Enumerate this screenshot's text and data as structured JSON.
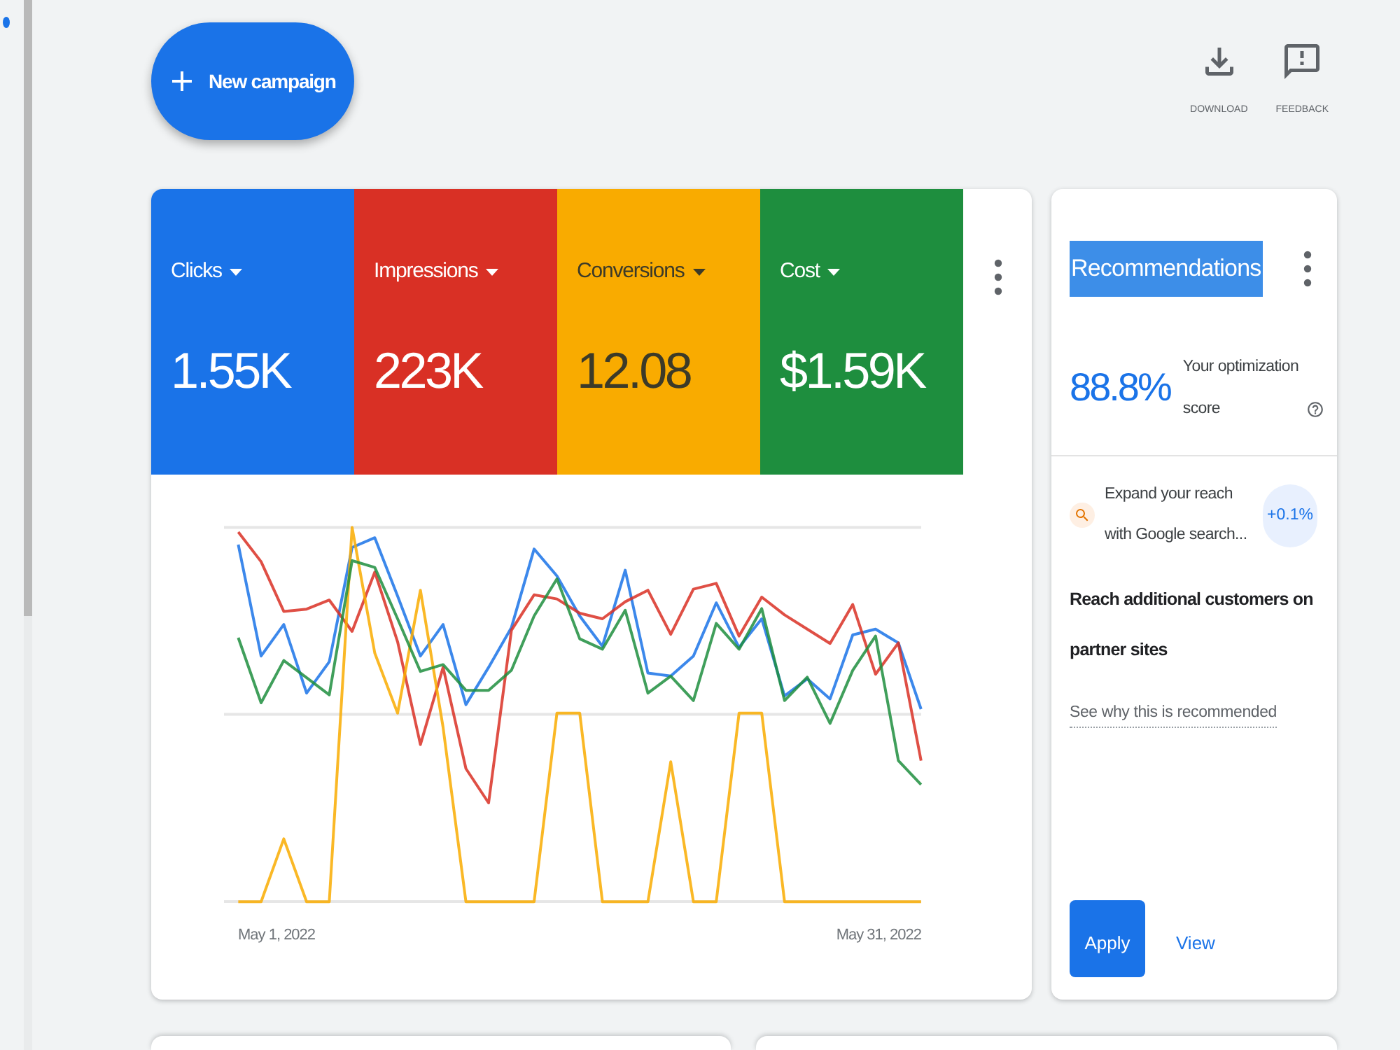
{
  "toolbar": {
    "new_campaign_label": "New campaign",
    "actions": [
      {
        "kind": "download",
        "label": "DOWNLOAD"
      },
      {
        "kind": "feedback",
        "label": "FEEDBACK"
      }
    ]
  },
  "performance_card": {
    "metrics": [
      {
        "label": "Clicks",
        "value": "1.55K",
        "color": "#1a73e8"
      },
      {
        "label": "Impressions",
        "value": "223K",
        "color": "#d93025"
      },
      {
        "label": "Conversions",
        "value": "12.08",
        "color": "#f9ab00"
      },
      {
        "label": "Cost",
        "value": "$1.59K",
        "color": "#1e8e3e"
      }
    ],
    "chart": {
      "x_start_label": "May 1, 2022",
      "x_end_label": "May 31, 2022"
    }
  },
  "recommendations_card": {
    "title": {
      "text": "Recommendations",
      "highlighted": true
    },
    "score": "88.8%",
    "score_label": "Your optimization score",
    "recommendation": {
      "summary": "Expand your reach with Google search...",
      "uplift": "+0.1%",
      "headline": "Reach additional customers on partner sites",
      "reason_link": "See why this is recommended",
      "buttons": [
        {
          "kind": "primary",
          "label": "Apply"
        },
        {
          "kind": "text",
          "label": "View"
        }
      ]
    }
  }
}
